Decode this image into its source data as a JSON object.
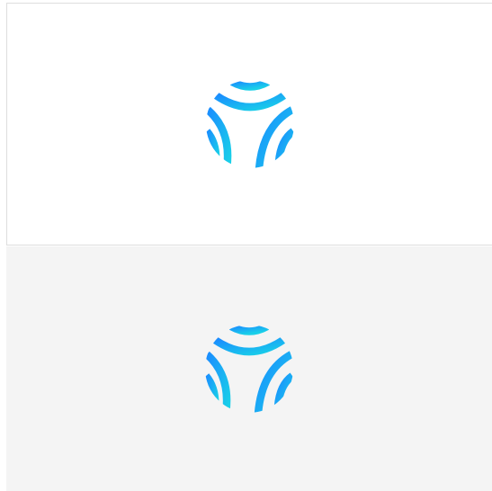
{
  "panels": [
    {
      "variant": "light-background",
      "background": "#ffffff",
      "logo": "globe-arcs-logo"
    },
    {
      "variant": "gray-background",
      "background": "#f4f4f4",
      "logo": "globe-arcs-logo"
    }
  ],
  "logo": {
    "icon": "globe-arcs-logo",
    "gradient_start": "#1a8cff",
    "gradient_end": "#19d0e8"
  }
}
